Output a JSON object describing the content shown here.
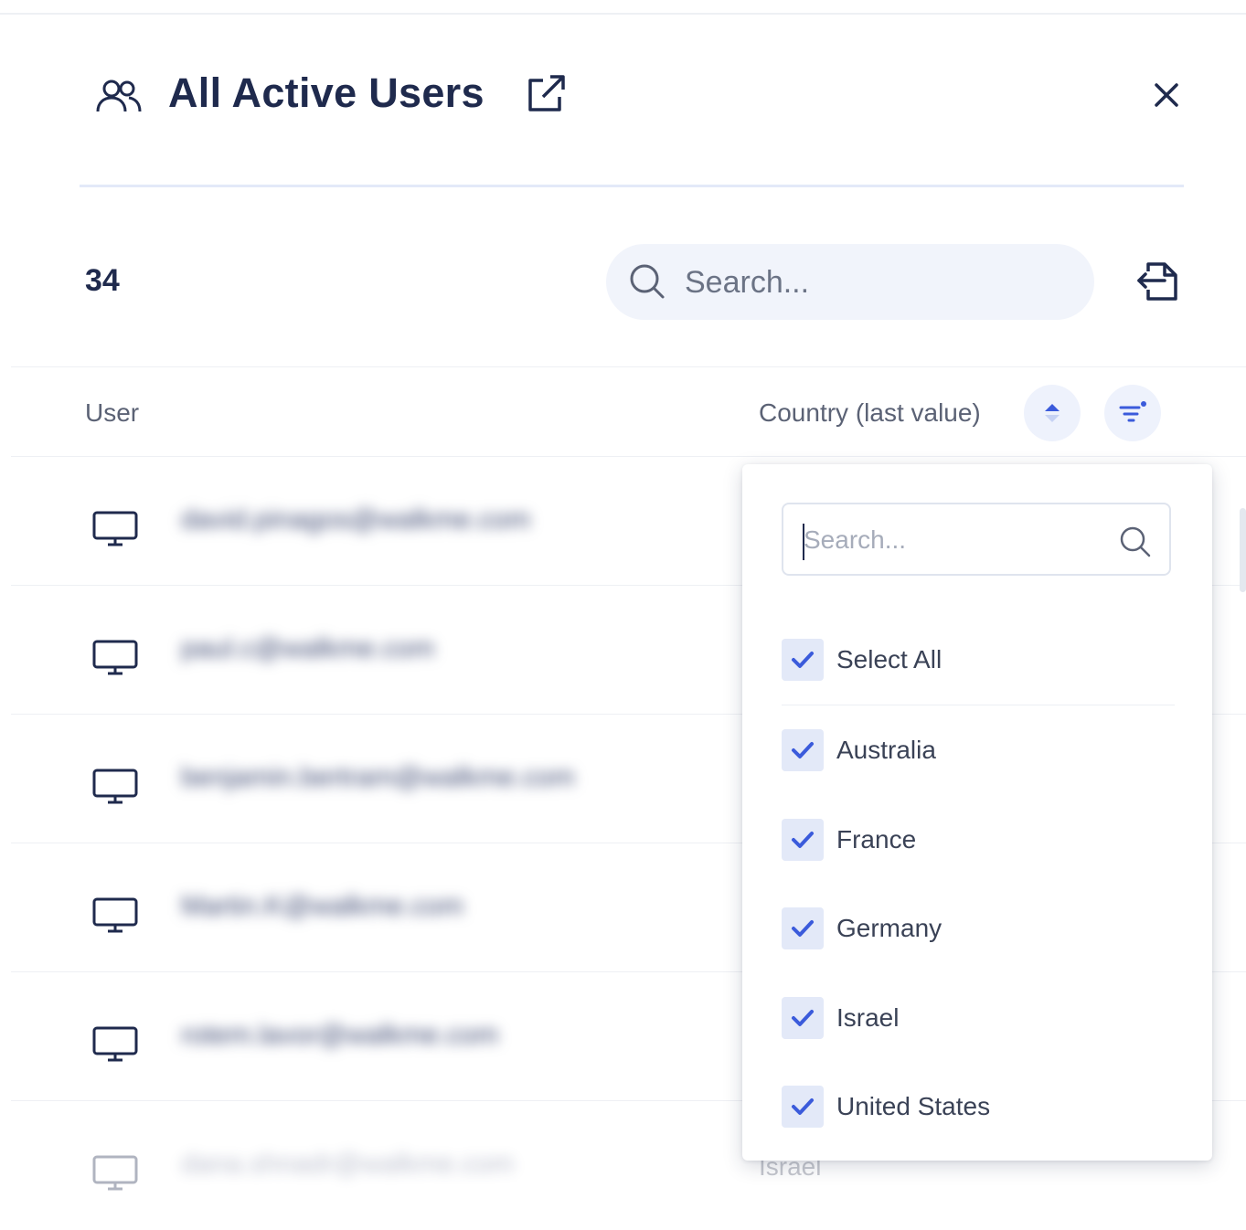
{
  "panel": {
    "title": "All Active Users",
    "count": "34"
  },
  "search": {
    "placeholder": "Search..."
  },
  "table": {
    "columns": {
      "user": "User",
      "country": "Country (last value)"
    },
    "rows": [
      {
        "email": "david.pinagos@walkme.com",
        "country": ""
      },
      {
        "email": "paul.c@walkme.com",
        "country": ""
      },
      {
        "email": "benjamin.bertram@walkme.com",
        "country": ""
      },
      {
        "email": "Martin.K@walkme.com",
        "country": ""
      },
      {
        "email": "rotem.lavor@walkme.com",
        "country": ""
      },
      {
        "email": "dana.shnadr@walkme.com",
        "country": "Israel"
      }
    ]
  },
  "filter_dropdown": {
    "search_placeholder": "Search...",
    "options": [
      {
        "label": "Select All",
        "checked": true
      },
      {
        "label": "Australia",
        "checked": true
      },
      {
        "label": "France",
        "checked": true
      },
      {
        "label": "Germany",
        "checked": true
      },
      {
        "label": "Israel",
        "checked": true
      },
      {
        "label": "United States",
        "checked": true
      }
    ]
  },
  "colors": {
    "title": "#1f2a4d",
    "accent": "#3b5bdb",
    "checkbox_bg": "#e3e9f8",
    "search_bg": "#f1f4fb"
  },
  "icons": [
    "users-icon",
    "open-external-icon",
    "close-icon",
    "search-icon",
    "export-icon",
    "sort-icon",
    "filter-icon",
    "desktop-icon",
    "check-icon"
  ]
}
